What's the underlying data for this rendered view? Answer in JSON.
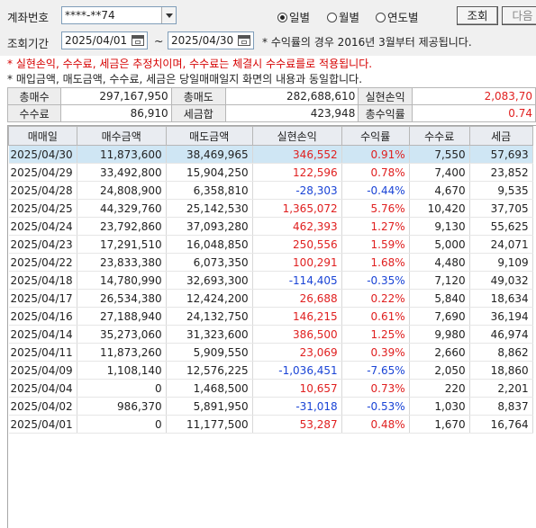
{
  "header": {
    "account_label": "계좌번호",
    "account_value": "****-**74",
    "period_label": "조회기간",
    "date_from": "2025/04/01",
    "date_to": "2025/04/30",
    "date_sep": "~",
    "period_note": "* 수익률의 경우 2016년 3월부터 제공됩니다.",
    "radios": [
      {
        "label": "일별",
        "selected": true
      },
      {
        "label": "월별",
        "selected": false
      },
      {
        "label": "연도별",
        "selected": false
      }
    ],
    "search_button": "조회",
    "next_button": "다음"
  },
  "notes": {
    "line1": "* 실현손익, 수수료, 세금은 추정치이며, 수수료는 체결시 수수료를로 적용됩니다.",
    "line2": "* 매입금액, 매도금액, 수수료, 세금은 당일매매일지 화면의 내용과 동일합니다."
  },
  "summary": {
    "buy_total_label": "총매수",
    "buy_total": "297,167,950",
    "sell_total_label": "총매도",
    "sell_total": "282,688,610",
    "realized_label": "실현손익",
    "realized": "2,083,70",
    "fee_label": "수수료",
    "fee": "86,910",
    "tax_total_label": "세금합",
    "tax_total": "423,948",
    "return_label": "총수익률",
    "return": "0.74"
  },
  "table": {
    "columns": [
      "매매일",
      "매수금액",
      "매도금액",
      "실현손익",
      "수익률",
      "수수료",
      "세금"
    ],
    "rows": [
      [
        "2025/04/30",
        "11,873,600",
        "38,469,965",
        "346,552",
        "0.91%",
        "7,550",
        "57,693"
      ],
      [
        "2025/04/29",
        "33,492,800",
        "15,904,250",
        "122,596",
        "0.78%",
        "7,400",
        "23,852"
      ],
      [
        "2025/04/28",
        "24,808,900",
        "6,358,810",
        "-28,303",
        "-0.44%",
        "4,670",
        "9,535"
      ],
      [
        "2025/04/25",
        "44,329,760",
        "25,142,530",
        "1,365,072",
        "5.76%",
        "10,420",
        "37,705"
      ],
      [
        "2025/04/24",
        "23,792,860",
        "37,093,280",
        "462,393",
        "1.27%",
        "9,130",
        "55,625"
      ],
      [
        "2025/04/23",
        "17,291,510",
        "16,048,850",
        "250,556",
        "1.59%",
        "5,000",
        "24,071"
      ],
      [
        "2025/04/22",
        "23,833,380",
        "6,073,350",
        "100,291",
        "1.68%",
        "4,480",
        "9,109"
      ],
      [
        "2025/04/18",
        "14,780,990",
        "32,693,300",
        "-114,405",
        "-0.35%",
        "7,120",
        "49,032"
      ],
      [
        "2025/04/17",
        "26,534,380",
        "12,424,200",
        "26,688",
        "0.22%",
        "5,840",
        "18,634"
      ],
      [
        "2025/04/16",
        "27,188,940",
        "24,132,750",
        "146,215",
        "0.61%",
        "7,690",
        "36,194"
      ],
      [
        "2025/04/14",
        "35,273,060",
        "31,323,600",
        "386,500",
        "1.25%",
        "9,980",
        "46,974"
      ],
      [
        "2025/04/11",
        "11,873,260",
        "5,909,550",
        "23,069",
        "0.39%",
        "2,660",
        "8,862"
      ],
      [
        "2025/04/09",
        "1,108,140",
        "12,576,225",
        "-1,036,451",
        "-7.65%",
        "2,050",
        "18,860"
      ],
      [
        "2025/04/04",
        "0",
        "1,468,500",
        "10,657",
        "0.73%",
        "220",
        "2,201"
      ],
      [
        "2025/04/02",
        "986,370",
        "5,891,950",
        "-31,018",
        "-0.53%",
        "1,030",
        "8,837"
      ],
      [
        "2025/04/01",
        "0",
        "11,177,500",
        "53,287",
        "0.48%",
        "1,670",
        "16,764"
      ]
    ]
  }
}
